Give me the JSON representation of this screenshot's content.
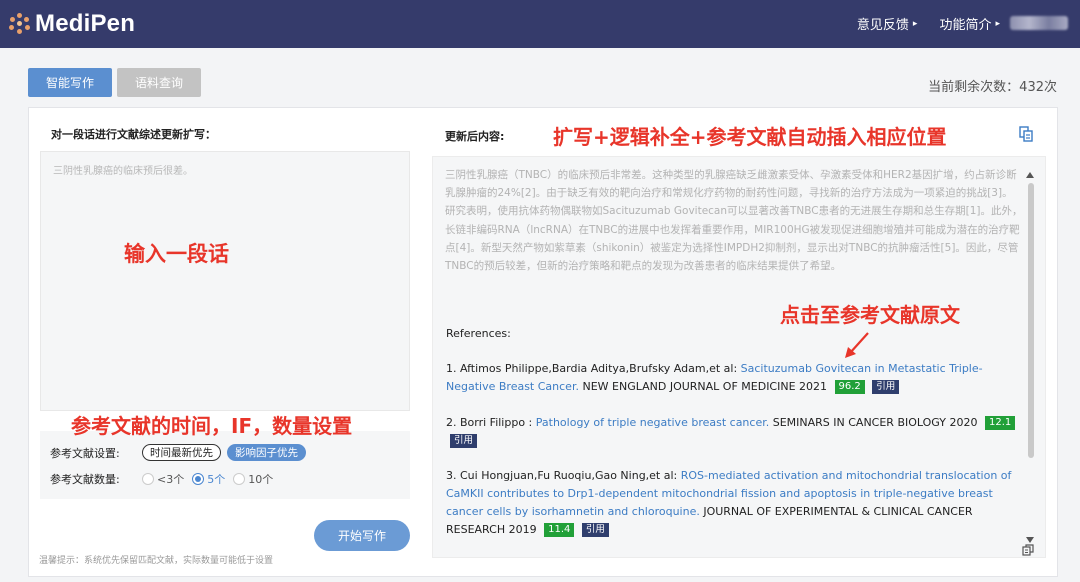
{
  "header": {
    "logo_text": "MediPen",
    "nav": [
      {
        "label": "意见反馈",
        "caret": "▸"
      },
      {
        "label": "功能简介",
        "caret": "▸"
      }
    ]
  },
  "tabs": [
    {
      "label": "智能写作",
      "active": true
    },
    {
      "label": "语料查询",
      "active": false
    }
  ],
  "remaining": "当前剩余次数：432次",
  "left": {
    "label": "对一段话进行文献综述更新扩写：",
    "input_text": "三阴性乳腺癌的临床预后很差。",
    "annotation_input": "输入一段话",
    "annotation_settings": "参考文献的时间，IF，数量设置",
    "time_setting_label": "参考文献设置:",
    "chips": [
      {
        "label": "时间最新优先",
        "active": false
      },
      {
        "label": "影响因子优先",
        "active": true
      }
    ],
    "count_setting_label": "参考文献数量:",
    "count_options": [
      {
        "label": "<3个",
        "selected": false
      },
      {
        "label": "5个",
        "selected": true
      },
      {
        "label": "10个",
        "selected": false
      }
    ],
    "start_button": "开始写作",
    "hint": "温馨提示：系统优先保留匹配文献，实际数量可能低于设置"
  },
  "right": {
    "label": "更新后内容:",
    "annotation_top": "扩写+逻辑补全+参考文献自动插入相应位置",
    "annotation_ref": "点击至参考文献原文",
    "output_text": "三阴性乳腺癌（TNBC）的临床预后非常差。这种类型的乳腺癌缺乏雌激素受体、孕激素受体和HER2基因扩增，约占新诊断乳腺肿瘤的24%[2]。由于缺乏有效的靶向治疗和常规化疗药物的耐药性问题，寻找新的治疗方法成为一项紧迫的挑战[3]。研究表明，使用抗体药物偶联物如Sacituzumab Govitecan可以显著改善TNBC患者的无进展生存期和总生存期[1]。此外，长链非编码RNA（lncRNA）在TNBC的进展中也发挥着重要作用，MIR100HG被发现促进细胞增殖并可能成为潜在的治疗靶点[4]。新型天然产物如紫草素（shikonin）被鉴定为选择性IMPDH2抑制剂，显示出对TNBC的抗肿瘤活性[5]。因此，尽管TNBC的预后较差，但新的治疗策略和靶点的发现为改善患者的临床结果提供了希望。",
    "refs_title": "References:",
    "references": [
      {
        "prefix": "1. Aftimos Philippe,Bardia Aditya,Brufsky Adam,et al: ",
        "title": "Sacituzumab Govitecan in Metastatic Triple-Negative Breast Cancer.",
        "journal": " NEW ENGLAND JOURNAL OF MEDICINE 2021",
        "if": "96.2",
        "cite": "引用"
      },
      {
        "prefix": "2. Borri Filippo : ",
        "title": "Pathology of triple negative breast cancer.",
        "journal": " SEMINARS IN CANCER BIOLOGY 2020",
        "if": "12.1",
        "cite": "引用"
      },
      {
        "prefix": "3. Cui Hongjuan,Fu Ruoqiu,Gao Ning,et al: ",
        "title": "ROS-mediated activation and mitochondrial translocation of CaMKII contributes to Drp1-dependent mitochondrial fission and apoptosis in triple-negative breast cancer cells by isorhamnetin and chloroquine.",
        "journal": " JOURNAL OF EXPERIMENTAL & CLINICAL CANCER RESEARCH 2019",
        "if": "11.4",
        "cite": "引用"
      }
    ]
  },
  "colors": {
    "topbar": "#353b6b",
    "accent_blue": "#5b8fd0",
    "annotation_red": "#e8352a",
    "link_blue": "#3c7cc4",
    "if_badge_green": "#21a038",
    "cite_badge_navy": "#2f3e6d"
  },
  "icons": [
    "logo-mark-icon",
    "copy-icon",
    "arrow-annotation-icon",
    "scroll-up-icon",
    "scroll-down-icon",
    "document-icon",
    "caret-right-icon"
  ]
}
